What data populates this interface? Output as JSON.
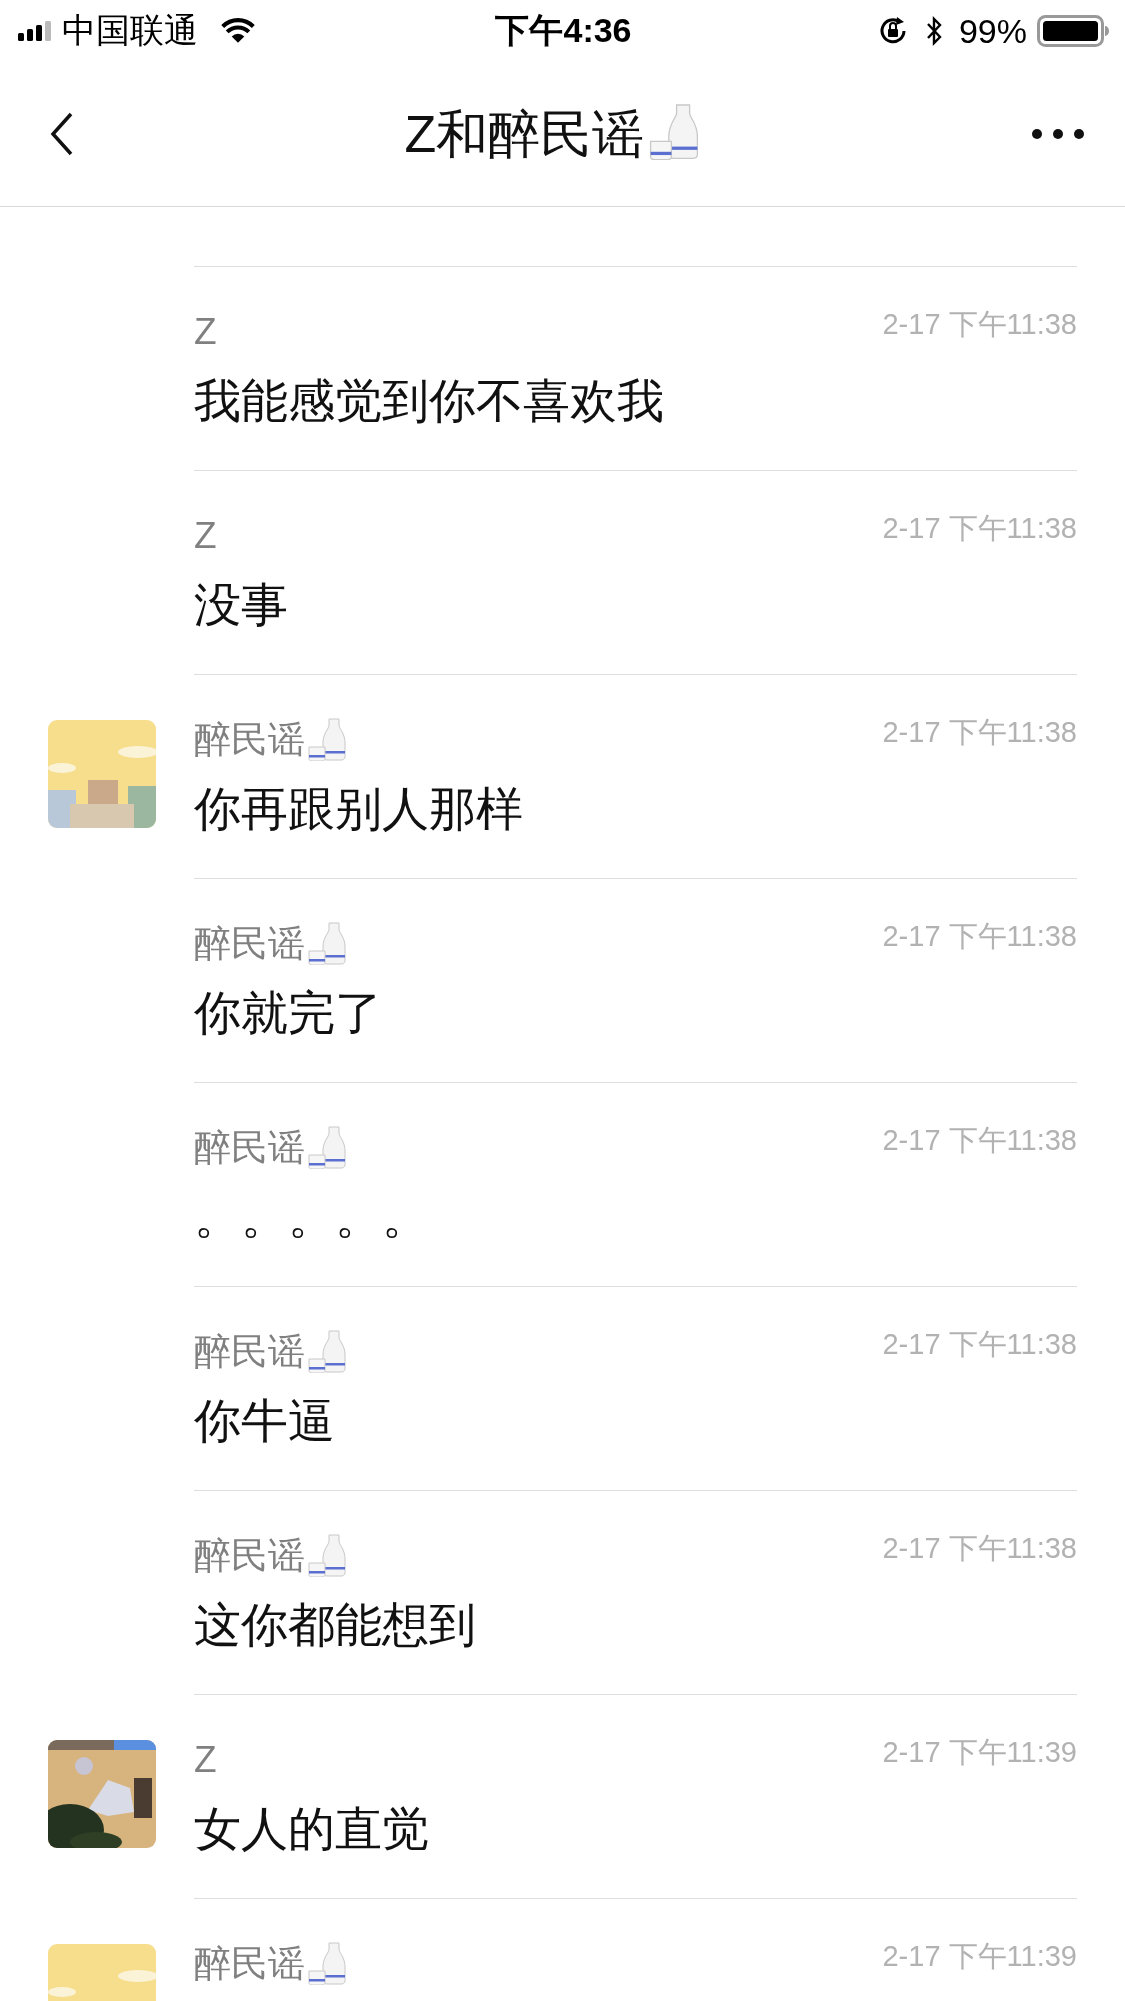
{
  "status_bar": {
    "carrier": "中国联通",
    "time": "下午4:36",
    "battery": "99%"
  },
  "nav": {
    "title": "Z和醉民谣",
    "title_icon": true
  },
  "messages": [
    {
      "sender": "Z",
      "name_icon": false,
      "time": "2-17 下午11:38",
      "text": "我能感觉到你不喜欢我",
      "avatar": false
    },
    {
      "sender": "Z",
      "name_icon": false,
      "time": "2-17 下午11:38",
      "text": "没事",
      "avatar": false
    },
    {
      "sender": "醉民谣",
      "name_icon": true,
      "time": "2-17 下午11:38",
      "text": "你再跟别人那样",
      "avatar": true
    },
    {
      "sender": "醉民谣",
      "name_icon": true,
      "time": "2-17 下午11:38",
      "text": "你就完了",
      "avatar": false
    },
    {
      "sender": "醉民谣",
      "name_icon": true,
      "time": "2-17 下午11:38",
      "text": "。。。。。",
      "avatar": false
    },
    {
      "sender": "醉民谣",
      "name_icon": true,
      "time": "2-17 下午11:38",
      "text": "你牛逼",
      "avatar": false
    },
    {
      "sender": "醉民谣",
      "name_icon": true,
      "time": "2-17 下午11:38",
      "text": "这你都能想到",
      "avatar": false
    },
    {
      "sender": "Z",
      "name_icon": false,
      "time": "2-17 下午11:39",
      "text": "女人的直觉",
      "avatar": true
    },
    {
      "sender": "醉民谣",
      "name_icon": true,
      "time": "2-17 下午11:39",
      "avatar": true
    }
  ]
}
